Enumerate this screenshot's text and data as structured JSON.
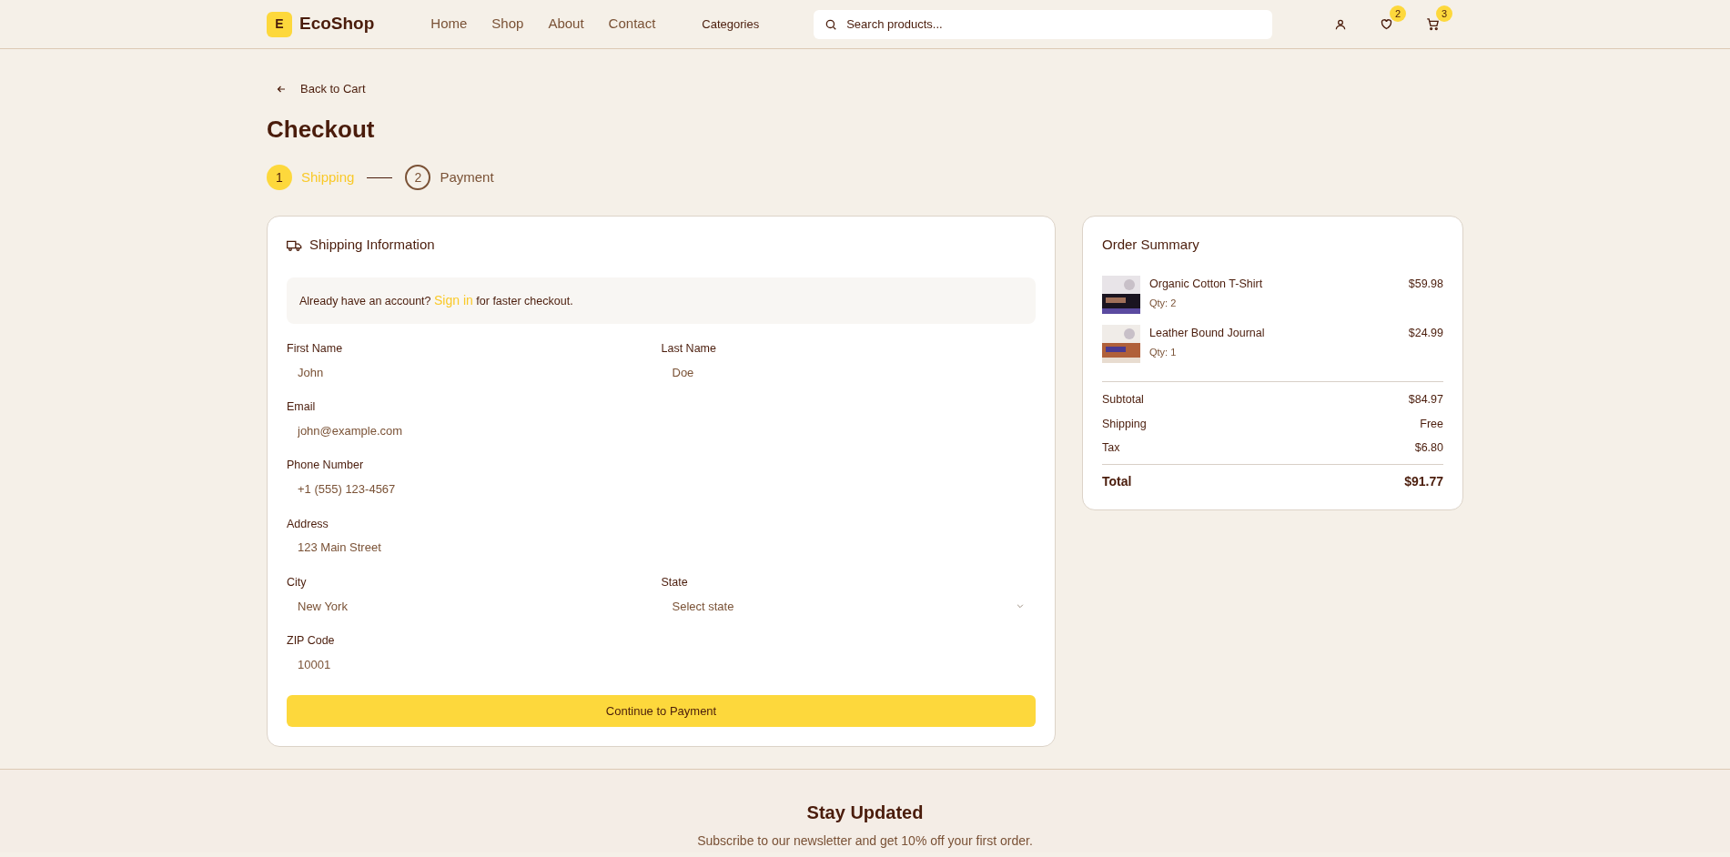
{
  "header": {
    "logo_letter": "E",
    "logo_name": "EcoShop",
    "nav": [
      {
        "label": "Home"
      },
      {
        "label": "Shop"
      },
      {
        "label": "About"
      },
      {
        "label": "Contact"
      }
    ],
    "categories": "Categories",
    "search": {
      "placeholder": "Search products..."
    },
    "actions": [
      {
        "kind": "user"
      },
      {
        "kind": "heart",
        "badge": "2"
      },
      {
        "kind": "cart",
        "badge": "3"
      }
    ]
  },
  "back_link": "Back to Cart",
  "title": "Checkout",
  "steps": [
    {
      "number": "1",
      "label": "Shipping",
      "selected": true
    },
    {
      "number": "2",
      "label": "Payment",
      "selected": false
    }
  ],
  "shipping": {
    "title": "Shipping Information",
    "signin_note": {
      "before": "Already have an account?",
      "link": "Sign in",
      "after": "for faster checkout."
    },
    "rows": [
      {
        "fields": [
          {
            "label": "First Name",
            "value": "John",
            "kind": "input"
          },
          {
            "label": "Last Name",
            "value": "Doe",
            "kind": "input"
          }
        ]
      },
      {
        "fields": [
          {
            "label": "Email",
            "value": "john@example.com",
            "kind": "input"
          }
        ]
      },
      {
        "fields": [
          {
            "label": "Phone Number",
            "value": "+1 (555) 123-4567",
            "kind": "input"
          }
        ]
      },
      {
        "fields": [
          {
            "label": "Address",
            "value": "123 Main Street",
            "kind": "input"
          }
        ]
      },
      {
        "fields": [
          {
            "label": "City",
            "value": "New York",
            "kind": "input"
          },
          {
            "label": "State",
            "value": "Select state",
            "kind": "select"
          }
        ]
      },
      {
        "fields": [
          {
            "label": "ZIP Code",
            "value": "10001",
            "kind": "input"
          }
        ]
      }
    ],
    "button": "Continue to Payment"
  },
  "summary": {
    "title": "Order Summary",
    "items": [
      {
        "name": "Organic Cotton T-Shirt",
        "qty": "Qty: 2",
        "price": "$59.98"
      },
      {
        "name": "Leather Bound Journal",
        "qty": "Qty: 1",
        "price": "$24.99"
      }
    ],
    "totals": [
      {
        "label": "Subtotal",
        "value": "$84.97",
        "kind": "line"
      },
      {
        "label": "Shipping",
        "value": "Free",
        "kind": "line"
      },
      {
        "label": "Tax",
        "value": "$6.80",
        "kind": "line"
      },
      {
        "label": "Total",
        "value": "$91.77",
        "kind": "total"
      }
    ]
  },
  "newsletter": {
    "title": "Stay Updated",
    "text": "Subscribe to our newsletter and get 10% off your first order."
  }
}
